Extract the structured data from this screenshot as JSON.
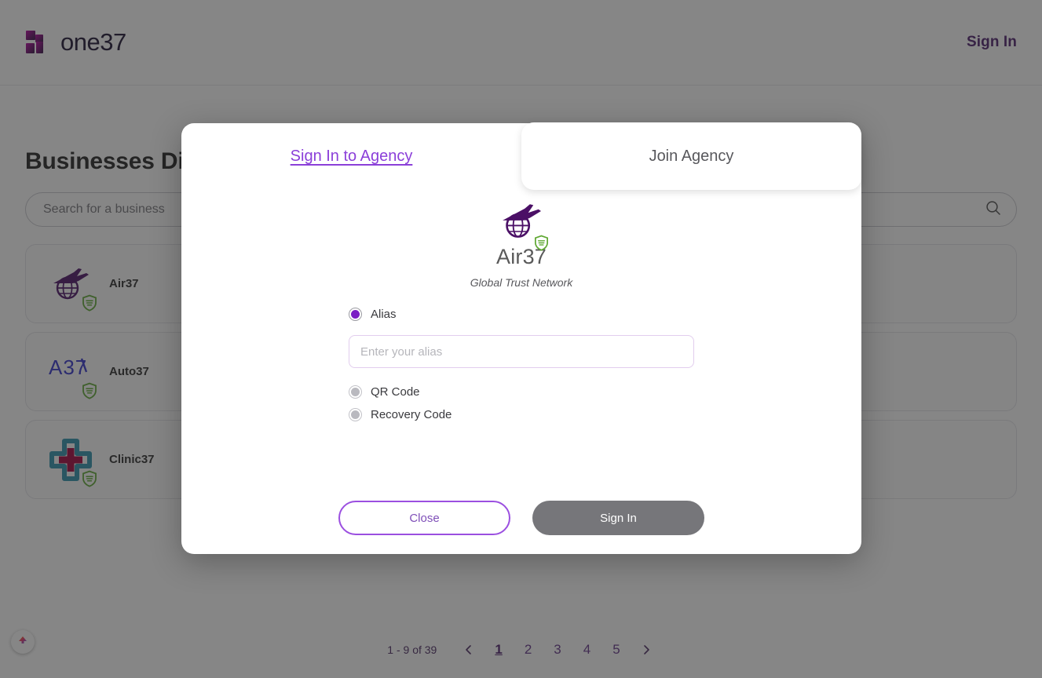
{
  "header": {
    "brand_word": "one37",
    "brand_mark_icon": "one37-logo-mark",
    "sign_in_label": "Sign In"
  },
  "directory": {
    "title": "Businesses Directory",
    "search_placeholder": "Search for a business",
    "search_value": "",
    "search_icon": "search-icon",
    "businesses": [
      {
        "name": "Air37",
        "logo_icon": "globe-airplane-icon",
        "badge_icon": "verified-shield-icon"
      },
      {
        "name": "Auto37",
        "logo_icon": "a37-wordmark-icon",
        "badge_icon": "verified-shield-icon"
      },
      {
        "name": "Clinic37",
        "logo_icon": "medical-cross-icon",
        "badge_icon": "verified-shield-icon"
      }
    ]
  },
  "pagination": {
    "range_label": "1 - 9 of 39",
    "prev_icon": "chevron-left-icon",
    "next_icon": "chevron-right-icon",
    "pages": [
      "1",
      "2",
      "3",
      "4",
      "5"
    ],
    "active_page": "1"
  },
  "widget": {
    "fab_icon": "gradient-arrow-widget-icon"
  },
  "modal": {
    "tabs": [
      {
        "label": "Sign In to Agency",
        "active": true
      },
      {
        "label": "Join Agency",
        "active": false
      }
    ],
    "agency": {
      "logo_icon": "globe-airplane-icon",
      "name": "Air37",
      "name_badge_icon": "verified-shield-icon",
      "tagline": "Global Trust Network"
    },
    "methods": [
      {
        "label": "Alias",
        "selected": true
      },
      {
        "label": "QR Code",
        "selected": false
      },
      {
        "label": "Recovery Code",
        "selected": false
      }
    ],
    "alias_input": {
      "placeholder": "Enter your alias",
      "value": ""
    },
    "close_label": "Close",
    "submit_label": "Sign In"
  },
  "colors": {
    "brand_purple": "#4b1d6b",
    "accent_purple": "#8b3fd9",
    "magenta": "#a3009b",
    "verified_green": "#5fa832",
    "disabled_gray": "#76767a",
    "overlay": "#2828288f"
  }
}
